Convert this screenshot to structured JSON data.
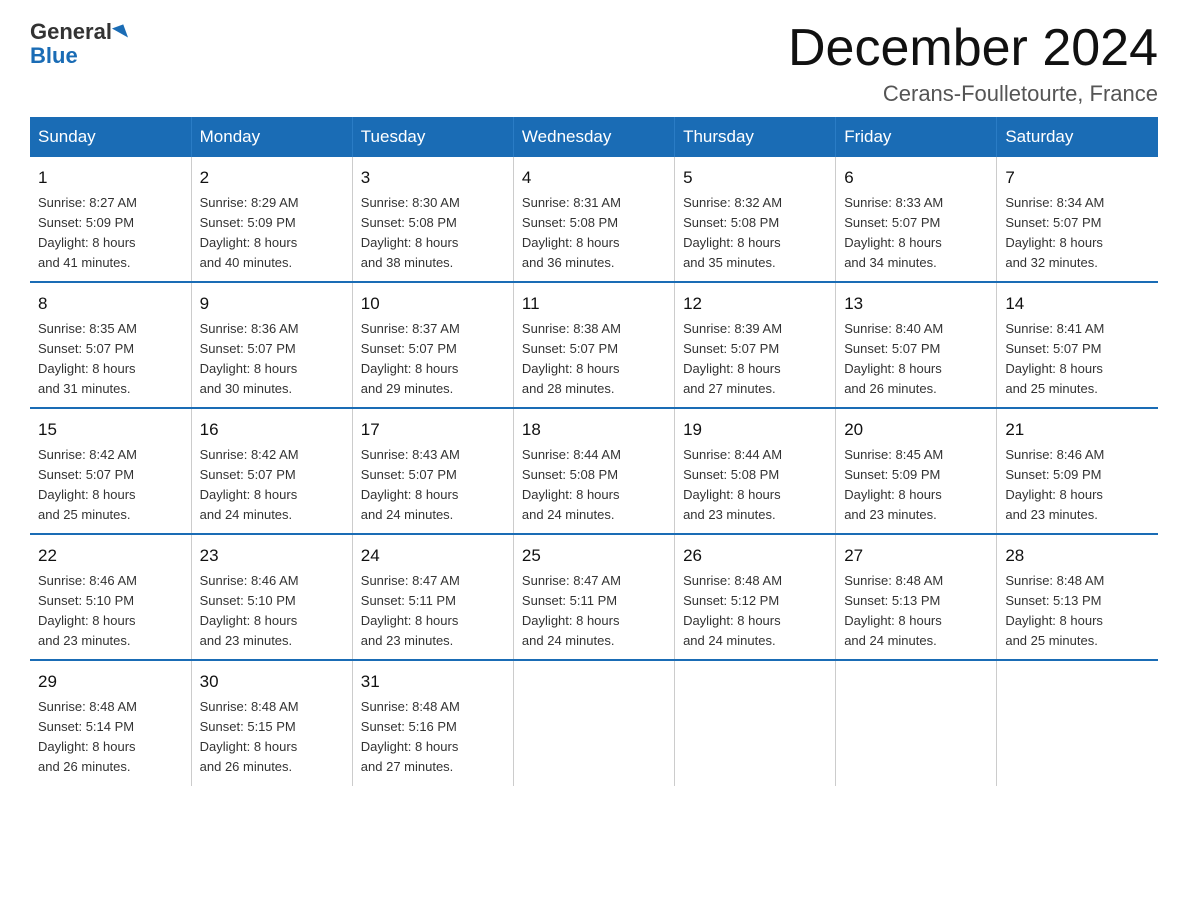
{
  "header": {
    "logo_general": "General",
    "logo_blue": "Blue",
    "month_title": "December 2024",
    "location": "Cerans-Foulletourte, France"
  },
  "days_of_week": [
    "Sunday",
    "Monday",
    "Tuesday",
    "Wednesday",
    "Thursday",
    "Friday",
    "Saturday"
  ],
  "weeks": [
    [
      {
        "day": "1",
        "info": "Sunrise: 8:27 AM\nSunset: 5:09 PM\nDaylight: 8 hours\nand 41 minutes."
      },
      {
        "day": "2",
        "info": "Sunrise: 8:29 AM\nSunset: 5:09 PM\nDaylight: 8 hours\nand 40 minutes."
      },
      {
        "day": "3",
        "info": "Sunrise: 8:30 AM\nSunset: 5:08 PM\nDaylight: 8 hours\nand 38 minutes."
      },
      {
        "day": "4",
        "info": "Sunrise: 8:31 AM\nSunset: 5:08 PM\nDaylight: 8 hours\nand 36 minutes."
      },
      {
        "day": "5",
        "info": "Sunrise: 8:32 AM\nSunset: 5:08 PM\nDaylight: 8 hours\nand 35 minutes."
      },
      {
        "day": "6",
        "info": "Sunrise: 8:33 AM\nSunset: 5:07 PM\nDaylight: 8 hours\nand 34 minutes."
      },
      {
        "day": "7",
        "info": "Sunrise: 8:34 AM\nSunset: 5:07 PM\nDaylight: 8 hours\nand 32 minutes."
      }
    ],
    [
      {
        "day": "8",
        "info": "Sunrise: 8:35 AM\nSunset: 5:07 PM\nDaylight: 8 hours\nand 31 minutes."
      },
      {
        "day": "9",
        "info": "Sunrise: 8:36 AM\nSunset: 5:07 PM\nDaylight: 8 hours\nand 30 minutes."
      },
      {
        "day": "10",
        "info": "Sunrise: 8:37 AM\nSunset: 5:07 PM\nDaylight: 8 hours\nand 29 minutes."
      },
      {
        "day": "11",
        "info": "Sunrise: 8:38 AM\nSunset: 5:07 PM\nDaylight: 8 hours\nand 28 minutes."
      },
      {
        "day": "12",
        "info": "Sunrise: 8:39 AM\nSunset: 5:07 PM\nDaylight: 8 hours\nand 27 minutes."
      },
      {
        "day": "13",
        "info": "Sunrise: 8:40 AM\nSunset: 5:07 PM\nDaylight: 8 hours\nand 26 minutes."
      },
      {
        "day": "14",
        "info": "Sunrise: 8:41 AM\nSunset: 5:07 PM\nDaylight: 8 hours\nand 25 minutes."
      }
    ],
    [
      {
        "day": "15",
        "info": "Sunrise: 8:42 AM\nSunset: 5:07 PM\nDaylight: 8 hours\nand 25 minutes."
      },
      {
        "day": "16",
        "info": "Sunrise: 8:42 AM\nSunset: 5:07 PM\nDaylight: 8 hours\nand 24 minutes."
      },
      {
        "day": "17",
        "info": "Sunrise: 8:43 AM\nSunset: 5:07 PM\nDaylight: 8 hours\nand 24 minutes."
      },
      {
        "day": "18",
        "info": "Sunrise: 8:44 AM\nSunset: 5:08 PM\nDaylight: 8 hours\nand 24 minutes."
      },
      {
        "day": "19",
        "info": "Sunrise: 8:44 AM\nSunset: 5:08 PM\nDaylight: 8 hours\nand 23 minutes."
      },
      {
        "day": "20",
        "info": "Sunrise: 8:45 AM\nSunset: 5:09 PM\nDaylight: 8 hours\nand 23 minutes."
      },
      {
        "day": "21",
        "info": "Sunrise: 8:46 AM\nSunset: 5:09 PM\nDaylight: 8 hours\nand 23 minutes."
      }
    ],
    [
      {
        "day": "22",
        "info": "Sunrise: 8:46 AM\nSunset: 5:10 PM\nDaylight: 8 hours\nand 23 minutes."
      },
      {
        "day": "23",
        "info": "Sunrise: 8:46 AM\nSunset: 5:10 PM\nDaylight: 8 hours\nand 23 minutes."
      },
      {
        "day": "24",
        "info": "Sunrise: 8:47 AM\nSunset: 5:11 PM\nDaylight: 8 hours\nand 23 minutes."
      },
      {
        "day": "25",
        "info": "Sunrise: 8:47 AM\nSunset: 5:11 PM\nDaylight: 8 hours\nand 24 minutes."
      },
      {
        "day": "26",
        "info": "Sunrise: 8:48 AM\nSunset: 5:12 PM\nDaylight: 8 hours\nand 24 minutes."
      },
      {
        "day": "27",
        "info": "Sunrise: 8:48 AM\nSunset: 5:13 PM\nDaylight: 8 hours\nand 24 minutes."
      },
      {
        "day": "28",
        "info": "Sunrise: 8:48 AM\nSunset: 5:13 PM\nDaylight: 8 hours\nand 25 minutes."
      }
    ],
    [
      {
        "day": "29",
        "info": "Sunrise: 8:48 AM\nSunset: 5:14 PM\nDaylight: 8 hours\nand 26 minutes."
      },
      {
        "day": "30",
        "info": "Sunrise: 8:48 AM\nSunset: 5:15 PM\nDaylight: 8 hours\nand 26 minutes."
      },
      {
        "day": "31",
        "info": "Sunrise: 8:48 AM\nSunset: 5:16 PM\nDaylight: 8 hours\nand 27 minutes."
      },
      {
        "day": "",
        "info": ""
      },
      {
        "day": "",
        "info": ""
      },
      {
        "day": "",
        "info": ""
      },
      {
        "day": "",
        "info": ""
      }
    ]
  ]
}
